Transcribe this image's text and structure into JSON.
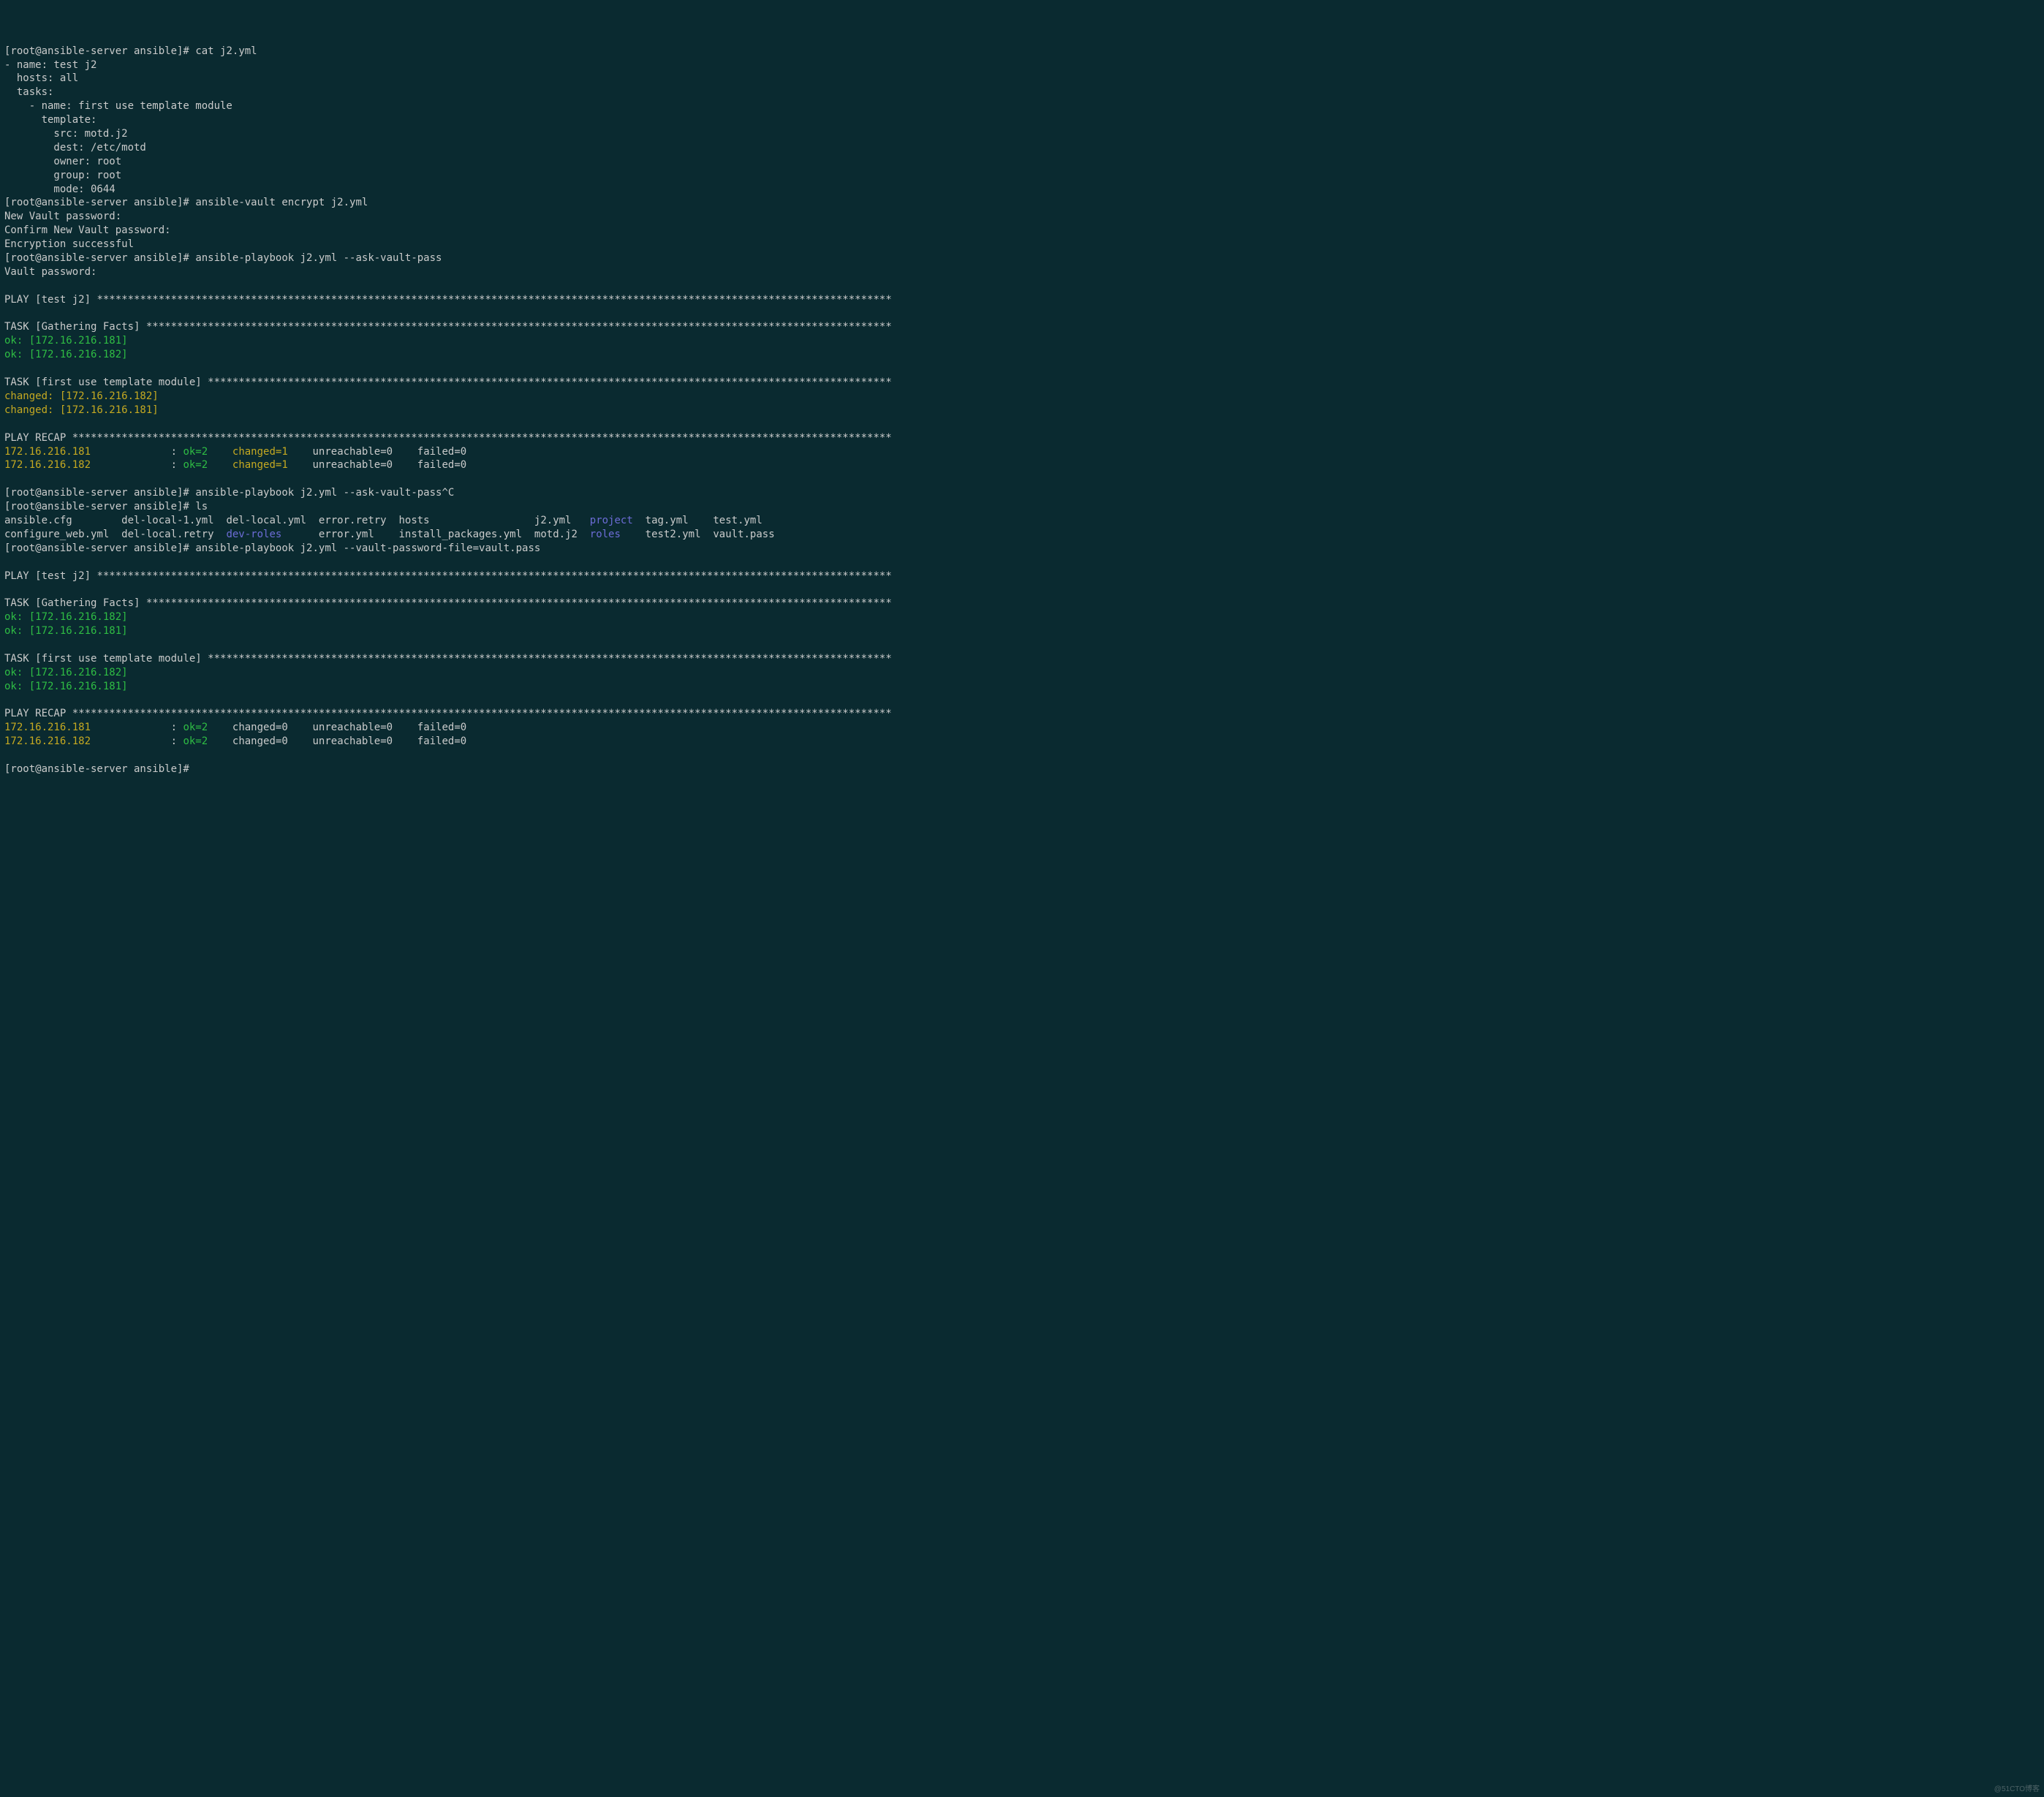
{
  "prompt": "[root@ansible-server ansible]#",
  "cmd_cat": "cat j2.yml",
  "yml_lines": [
    "- name: test j2",
    "  hosts: all",
    "  tasks:",
    "    - name: first use template module",
    "      template:",
    "        src: motd.j2",
    "        dest: /etc/motd",
    "        owner: root",
    "        group: root",
    "        mode: 0644"
  ],
  "cmd_encrypt": "ansible-vault encrypt j2.yml",
  "vault_new_pass": "New Vault password: ",
  "vault_confirm": "Confirm New Vault password: ",
  "vault_success": "Encryption successful",
  "cmd_playbook1": "ansible-playbook j2.yml --ask-vault-pass",
  "vault_pass": "Vault password: ",
  "play_header": "PLAY [test j2] ",
  "task_gather": "TASK [Gathering Facts] ",
  "ok_181": "ok: [172.16.216.181]",
  "ok_182": "ok: [172.16.216.182]",
  "task_template": "TASK [first use template module] ",
  "changed_182": "changed: [172.16.216.182]",
  "changed_181": "changed: [172.16.216.181]",
  "recap_header": "PLAY RECAP ",
  "recap1": {
    "host1": "172.16.216.181             ",
    "host2": "172.16.216.182             ",
    "colon": ": ",
    "ok": "ok=2   ",
    "changed": "changed=1   ",
    "rest": "unreachable=0    failed=0   "
  },
  "cmd_playbook_c": "ansible-playbook j2.yml --ask-vault-pass^C",
  "cmd_ls": "ls",
  "ls_row1": {
    "c1": "ansible.cfg        ",
    "c2": "del-local-1.yml  ",
    "c3": "del-local.yml  ",
    "c4": "error.retry  ",
    "c5": "hosts                 ",
    "c6": "j2.yml   ",
    "c7": "project",
    "c8": "  tag.yml    ",
    "c9": "test.yml"
  },
  "ls_row2": {
    "c1": "configure_web.yml  ",
    "c2": "del-local.retry  ",
    "c3": "dev-roles",
    "c4": "      error.yml    ",
    "c5": "install_packages.yml  ",
    "c6": "motd.j2  ",
    "c7": "roles",
    "c8": "    test2.yml  ",
    "c9": "vault.pass"
  },
  "cmd_playbook2": "ansible-playbook j2.yml --vault-password-file=vault.pass",
  "recap2": {
    "host1": "172.16.216.181             ",
    "host2": "172.16.216.182             ",
    "colon": ": ",
    "ok": "ok=2   ",
    "changed": "changed=0   ",
    "rest": "unreachable=0    failed=0   "
  },
  "stars_play": "*********************************************************************************************************************************",
  "stars_gather": "*************************************************************************************************************************",
  "stars_template": "***************************************************************************************************************",
  "stars_recap": "*************************************************************************************************************************************",
  "watermark": "@51CTO博客"
}
